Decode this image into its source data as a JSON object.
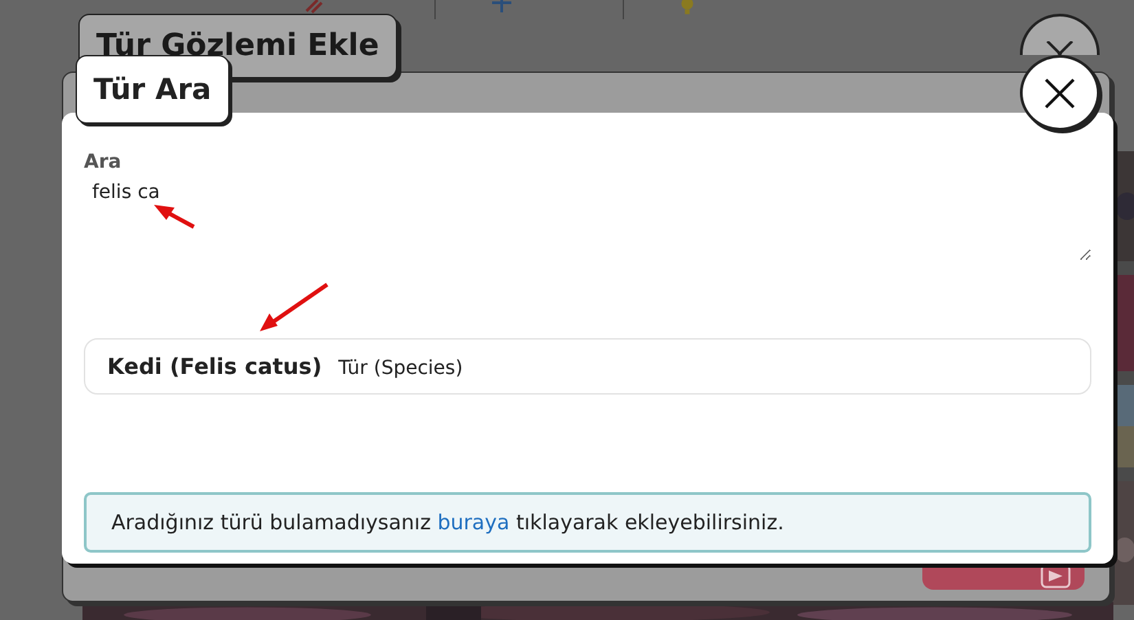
{
  "back_dialog": {
    "title": "Tür Gözlemi Ekle"
  },
  "dialog": {
    "title": "Tür Ara",
    "search": {
      "label": "Ara",
      "value": "felis ca"
    },
    "results": [
      {
        "name": "Kedi (Felis catus)",
        "rank": "Tür (Species)"
      }
    ],
    "notice": {
      "before": "Aradığınız türü bulamadıysanız",
      "link": "buraya",
      "after": "tıklayarak ekleyebilirsiniz."
    }
  }
}
